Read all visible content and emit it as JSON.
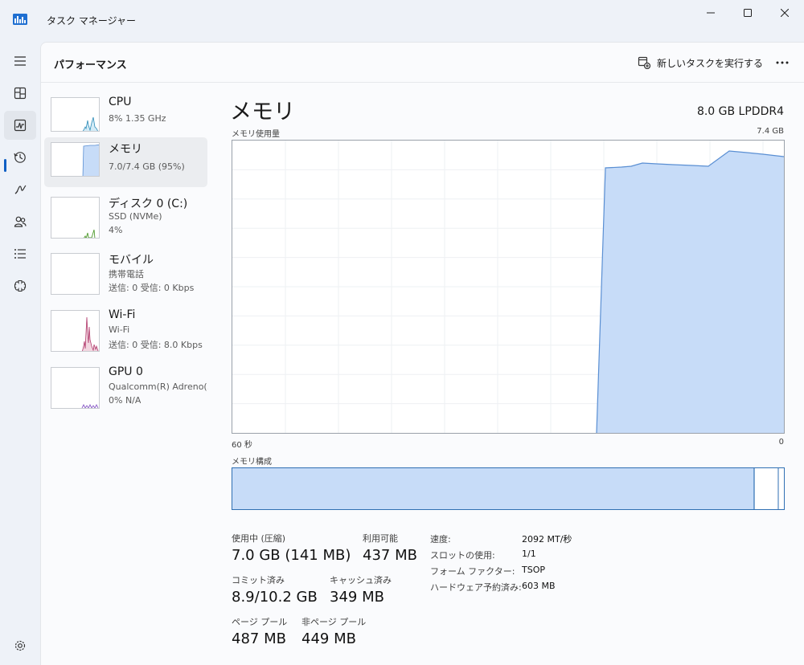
{
  "window": {
    "title": "タスク マネージャー"
  },
  "header": {
    "title": "パフォーマンス",
    "run_task_label": "新しいタスクを実行する"
  },
  "nav": {
    "items": [
      "menu-icon",
      "processes-icon",
      "performance-icon",
      "app-history-icon",
      "startup-apps-icon",
      "users-icon",
      "details-icon",
      "services-icon",
      "settings-icon"
    ],
    "active": "performance-icon"
  },
  "resources": [
    {
      "name": "CPU",
      "line1": "8%  1.35 GHz"
    },
    {
      "name": "メモリ",
      "line1": "7.0/7.4 GB (95%)"
    },
    {
      "name": "ディスク 0 (C:)",
      "line1": "SSD (NVMe)",
      "line2": "4%"
    },
    {
      "name": "モバイル",
      "line1": "携帯電話",
      "line2": "送信: 0 受信: 0 Kbps"
    },
    {
      "name": "Wi-Fi",
      "line1": "Wi-Fi",
      "line2": "送信: 0 受信: 8.0 Kbps"
    },
    {
      "name": "GPU 0",
      "line1": "Qualcomm(R) Adreno(...",
      "line2": "0%  N/A"
    }
  ],
  "detail": {
    "title": "メモリ",
    "spec": "8.0 GB LPDDR4",
    "usage_label": "メモリ使用量",
    "usage_max": "7.4 GB",
    "time_left": "60 秒",
    "time_right": "0",
    "composition_label": "メモリ構成",
    "stats": {
      "in_use_label": "使用中 (圧縮)",
      "in_use_value": "7.0 GB (141 MB)",
      "available_label": "利用可能",
      "available_value": "437 MB",
      "committed_label": "コミット済み",
      "committed_value": "8.9/10.2 GB",
      "cached_label": "キャッシュ済み",
      "cached_value": "349 MB",
      "paged_label": "ページ プール",
      "paged_value": "487 MB",
      "nonpaged_label": "非ページ プール",
      "nonpaged_value": "449 MB"
    },
    "specs": [
      {
        "label": "速度:",
        "value": "2092 MT/秒"
      },
      {
        "label": "スロットの使用:",
        "value": "1/1"
      },
      {
        "label": "フォーム ファクター:",
        "value": "TSOP"
      },
      {
        "label": "ハードウェア予約済み:",
        "value": "603 MB"
      }
    ]
  },
  "colors": {
    "memory_fill": "#c7dcf8",
    "memory_line": "#5a8fd3",
    "cpu_line": "#2e8cb8",
    "wifi_line": "#b1396b",
    "gpu_line": "#8a5cc7",
    "disk_line": "#4e9a2c",
    "accent": "#0f5fc4"
  }
}
